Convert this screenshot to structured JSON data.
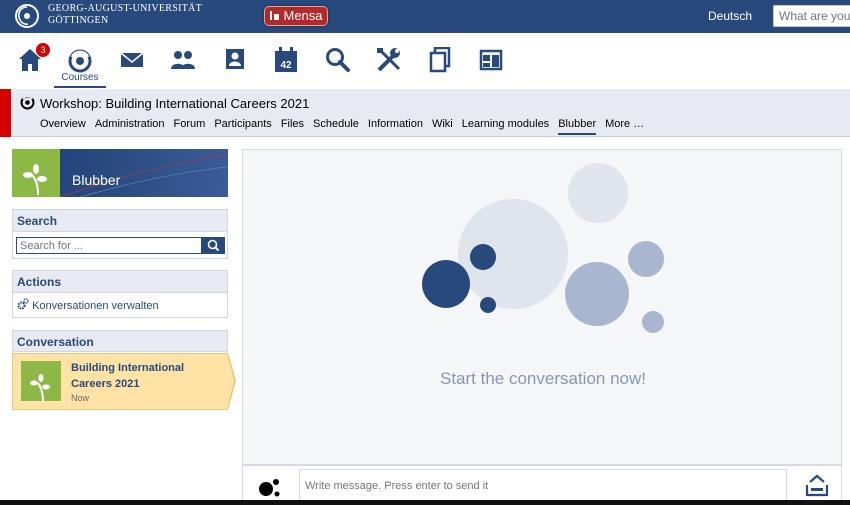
{
  "header": {
    "university_line1": "GEORG-AUGUST-UNIVERSITÄT",
    "university_line2": "GÖTTINGEN",
    "mensa_label": "Mensa",
    "language": "Deutsch",
    "search_placeholder": "What are you l"
  },
  "icon_nav": {
    "home_badge": "3",
    "courses_label": "Courses",
    "icons": [
      "home-icon",
      "courses-icon",
      "mail-icon",
      "community-icon",
      "profile-icon",
      "schedule-icon",
      "search-icon",
      "tools-icon",
      "files-icon",
      "rooms-icon"
    ],
    "calendar_number": "42"
  },
  "course": {
    "title": "Workshop: Building International Careers 2021",
    "tabs": [
      "Overview",
      "Administration",
      "Forum",
      "Participants",
      "Files",
      "Schedule",
      "Information",
      "Wiki",
      "Learning modules",
      "Blubber",
      "More …"
    ],
    "active_tab": "Blubber"
  },
  "sidebar": {
    "banner_title": "Blubber",
    "search_title": "Search",
    "search_placeholder": "Search for ...",
    "actions_title": "Actions",
    "action_item": "Konversationen verwalten",
    "conversation_title": "Conversation",
    "conversation_name": "Building International Careers 2021",
    "conversation_time": "Now"
  },
  "main": {
    "empty_text": "Start the conversation now!",
    "message_placeholder": "Write message. Press enter to send it"
  },
  "colors": {
    "brand": "#28497c",
    "accent_red": "#d60000",
    "highlight": "#ffe3a6"
  }
}
